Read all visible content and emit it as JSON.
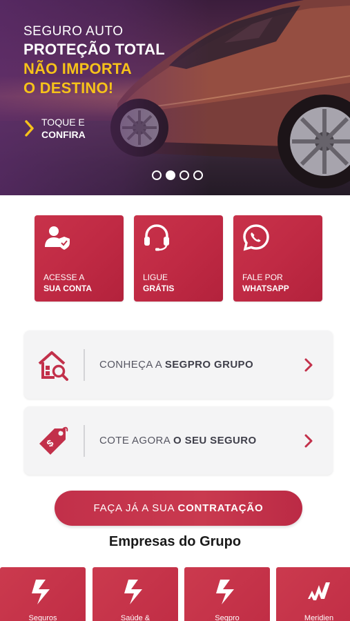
{
  "hero": {
    "line1": "SEGURO AUTO",
    "line2": "PROTEÇÃO TOTAL",
    "line3": "NÃO IMPORTA",
    "line4": "O DESTINO!",
    "cta_line1": "TOQUE E",
    "cta_line2": "CONFIRA",
    "carousel_total": 4,
    "carousel_active": 2,
    "accent_color": "#f6c21a"
  },
  "actions": [
    {
      "line1": "ACESSE A",
      "line2": "SUA CONTA",
      "icon": "user-shield-icon"
    },
    {
      "line1": "LIGUE",
      "line2": "GRÁTIS",
      "icon": "headset-icon"
    },
    {
      "line1": "FALE POR",
      "line2": "WHATSAPP",
      "icon": "whatsapp-icon"
    }
  ],
  "cards": [
    {
      "text": "CONHEÇA A",
      "bold": "SEGPRO GRUPO",
      "icon": "house-search-icon"
    },
    {
      "text": "COTE AGORA",
      "bold": "O SEU SEGURO",
      "icon": "price-tag-icon"
    }
  ],
  "main_button": {
    "text": "FAÇA JÁ A SUA",
    "bold": "CONTRATAÇÃO"
  },
  "group_title": "Empresas do Grupo",
  "companies": [
    {
      "name": "Seguros",
      "icon": "s-logo-icon"
    },
    {
      "name": "Saúde &",
      "icon": "s-logo-icon"
    },
    {
      "name": "Segpro",
      "icon": "s-logo-icon"
    },
    {
      "name": "Meridien",
      "icon": "m-logo-icon"
    }
  ],
  "colors": {
    "brand": "#c2304a",
    "card_bg": "#f4f4f5"
  }
}
